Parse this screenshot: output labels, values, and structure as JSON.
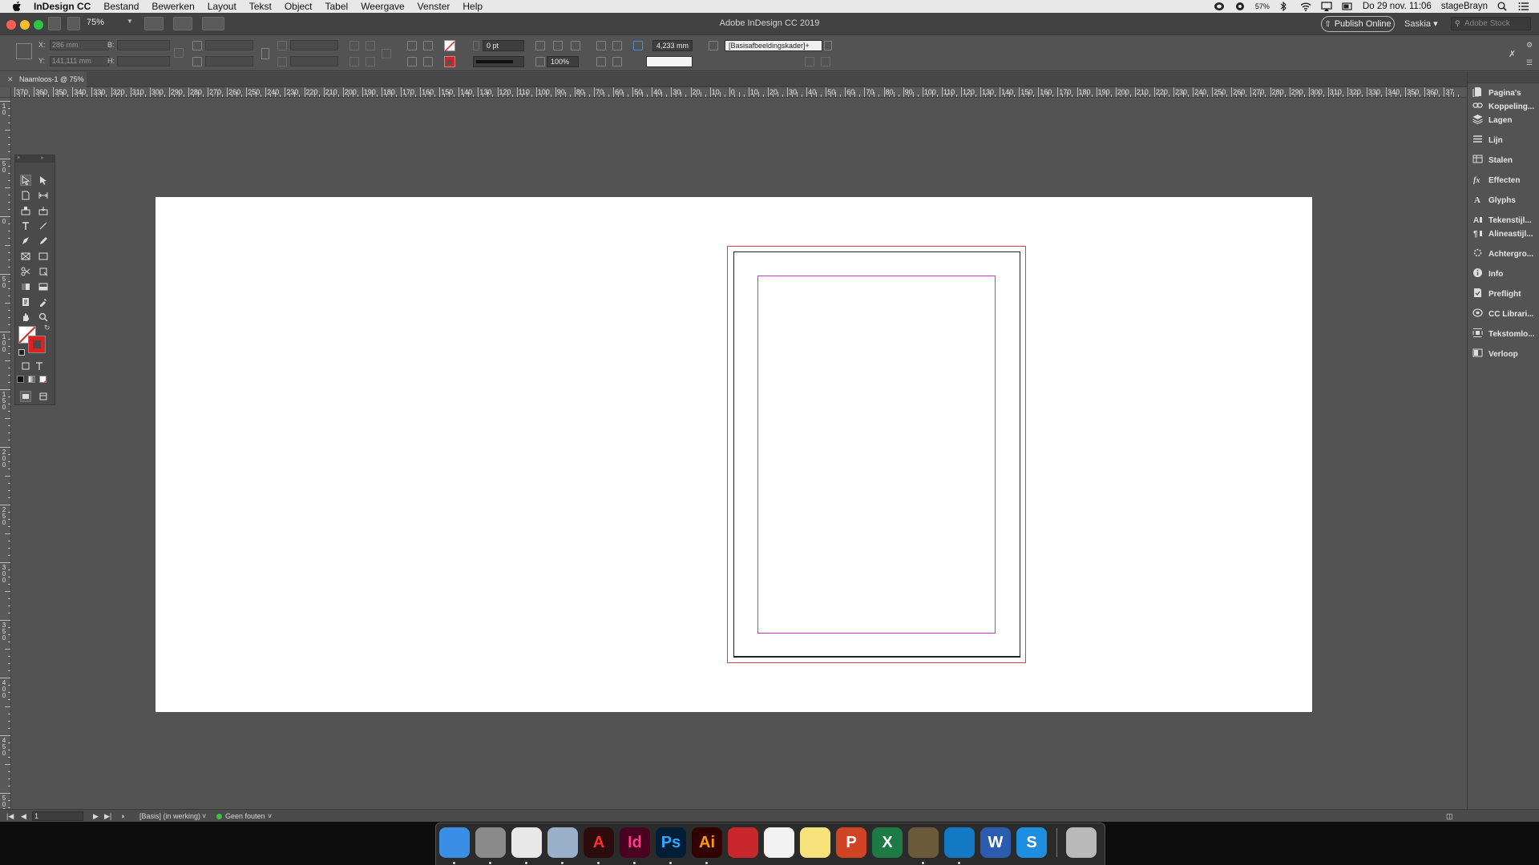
{
  "menubar": {
    "app_name": "InDesign CC",
    "items": [
      "Bestand",
      "Bewerken",
      "Layout",
      "Tekst",
      "Object",
      "Tabel",
      "Weergave",
      "Venster",
      "Help"
    ],
    "battery": "57%",
    "datetime": "Do 29 nov. 11:06",
    "user": "stageBrayn"
  },
  "titlebar": {
    "title": "Adobe InDesign CC 2019",
    "zoom": "75%",
    "publish_label": "Publish Online",
    "workspace_user": "Saskia",
    "stock_placeholder": "Adobe Stock"
  },
  "controlbar": {
    "x_label": "X:",
    "x_value": "286 mm",
    "y_label": "Y:",
    "y_value": "141,111 mm",
    "w_label": "B:",
    "h_label": "H:",
    "stroke_weight": "0 pt",
    "scale_value": "100%",
    "gap_value": "4,233 mm",
    "object_style": "[Basisafbeeldingskader]+"
  },
  "document": {
    "tab_label": "Naamloos-1 @ 75%"
  },
  "rulers": {
    "horizontal_labels": [
      "370",
      "360",
      "350",
      "340",
      "330",
      "320",
      "310",
      "300",
      "290",
      "280",
      "270",
      "260",
      "250",
      "240",
      "230",
      "220",
      "210",
      "200",
      "190",
      "180",
      "170",
      "160",
      "150",
      "140",
      "130",
      "120",
      "110",
      "100",
      "90",
      "80",
      "70",
      "60",
      "50",
      "40",
      "30",
      "20",
      "10",
      "0",
      "10",
      "20",
      "30",
      "40",
      "50",
      "60",
      "70",
      "80",
      "90",
      "100",
      "110",
      "120",
      "130",
      "140",
      "150",
      "160",
      "170",
      "180",
      "190",
      "200",
      "210",
      "220",
      "230",
      "240",
      "250",
      "260",
      "270",
      "280",
      "290",
      "300",
      "310",
      "320",
      "330",
      "340",
      "350",
      "360",
      "37"
    ],
    "vertical_labels": [
      "1 0",
      "5 0",
      "0",
      "5 0",
      "1 0 0",
      "1 5 0",
      "2 0 0",
      "2 5 0",
      "3 0 0",
      "3 5 0",
      "4 0 0",
      "4 5 0",
      "5 0 0"
    ]
  },
  "panels": {
    "items": [
      {
        "label": "Pagina's",
        "icon": "pages-icon"
      },
      {
        "label": "Koppeling...",
        "icon": "links-icon"
      },
      {
        "label": "Lagen",
        "icon": "layers-icon"
      },
      {
        "label": "Lijn",
        "icon": "stroke-icon"
      },
      {
        "label": "Stalen",
        "icon": "swatches-icon"
      },
      {
        "label": "Effecten",
        "icon": "effects-icon"
      },
      {
        "label": "Glyphs",
        "icon": "glyphs-icon"
      },
      {
        "label": "Tekenstijl...",
        "icon": "character-styles-icon"
      },
      {
        "label": "Alineastijl...",
        "icon": "paragraph-styles-icon"
      },
      {
        "label": "Achtergro...",
        "icon": "background-tasks-icon"
      },
      {
        "label": "Info",
        "icon": "info-icon"
      },
      {
        "label": "Preflight",
        "icon": "preflight-icon"
      },
      {
        "label": "CC Librari...",
        "icon": "cc-libraries-icon"
      },
      {
        "label": "Tekstomlo...",
        "icon": "text-wrap-icon"
      },
      {
        "label": "Verloop",
        "icon": "gradient-icon"
      }
    ]
  },
  "statusbar": {
    "page_number": "1",
    "style_text": "[Basis] (in werking)",
    "preflight_text": "Geen fouten",
    "preflight_color": "#3fbf3f"
  },
  "dock": {
    "apps": [
      {
        "name": "Finder",
        "icon": "finder-icon",
        "color": "#3a8ee6"
      },
      {
        "name": "System Preferences",
        "icon": "system-preferences-icon",
        "color": "#8a8a8a"
      },
      {
        "name": "Chrome",
        "icon": "chrome-icon",
        "color": "#e8e8e8"
      },
      {
        "name": "Preview",
        "icon": "preview-icon",
        "color": "#9ab0c8"
      },
      {
        "name": "Acrobat",
        "icon": "acrobat-icon",
        "color": "#2b0b0b",
        "glyph": "A"
      },
      {
        "name": "InDesign",
        "icon": "indesign-icon",
        "color": "#49021f",
        "glyph": "Id"
      },
      {
        "name": "Photoshop",
        "icon": "photoshop-icon",
        "color": "#001e36",
        "glyph": "Ps"
      },
      {
        "name": "Illustrator",
        "icon": "illustrator-icon",
        "color": "#330000",
        "glyph": "Ai"
      },
      {
        "name": "Creative Cloud",
        "icon": "creative-cloud-icon",
        "color": "#c8272c"
      },
      {
        "name": "TextEdit",
        "icon": "textedit-icon",
        "color": "#f2f2f2"
      },
      {
        "name": "Notes",
        "icon": "notes-icon",
        "color": "#f7e27b"
      },
      {
        "name": "PowerPoint",
        "icon": "powerpoint-icon",
        "color": "#d04423",
        "glyph": "P"
      },
      {
        "name": "Excel",
        "icon": "excel-icon",
        "color": "#1d7a45",
        "glyph": "X"
      },
      {
        "name": "Sequel",
        "icon": "sequel-icon",
        "color": "#6b5a3a"
      },
      {
        "name": "Trello",
        "icon": "trello-icon",
        "color": "#1479c4"
      },
      {
        "name": "Word",
        "icon": "word-icon",
        "color": "#2b5caf",
        "glyph": "W"
      },
      {
        "name": "Skype",
        "icon": "skype-icon",
        "color": "#1e8fe0",
        "glyph": "S"
      },
      {
        "name": "Trash",
        "icon": "trash-icon",
        "color": "#b9b9b9"
      }
    ]
  }
}
